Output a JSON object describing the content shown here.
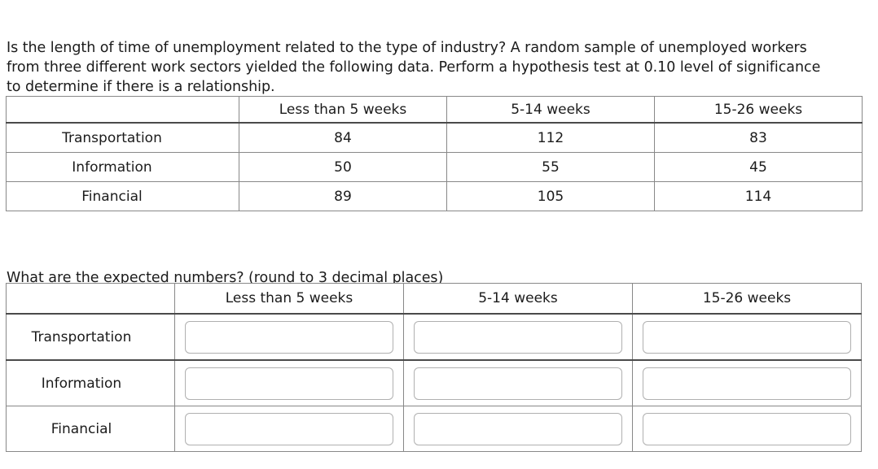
{
  "prompt": {
    "intro": "Is the length of time of unemployment related to the type of industry? A random sample of unemployed workers from three different work sectors yielded the following data. Perform a hypothesis test at 0.10 level of significance to determine if there is a relationship.",
    "expected_question": "What are the expected numbers? (round to 3 decimal places)"
  },
  "observed_table": {
    "corner_label": "",
    "columns": [
      "Less than 5 weeks",
      "5-14 weeks",
      "15-26 weeks"
    ],
    "rows": [
      {
        "label": "Transportation",
        "values": [
          "84",
          "112",
          "83"
        ]
      },
      {
        "label": "Information",
        "values": [
          "50",
          "55",
          "45"
        ]
      },
      {
        "label": "Financial",
        "values": [
          "89",
          "105",
          "114"
        ]
      }
    ]
  },
  "expected_table": {
    "corner_label": "",
    "columns": [
      "Less than 5 weeks",
      "5-14 weeks",
      "15-26 weeks"
    ],
    "rows": [
      {
        "label": "Transportation",
        "values": [
          "",
          "",
          ""
        ],
        "placeholders": [
          "",
          "",
          ""
        ]
      },
      {
        "label": "Information",
        "values": [
          "",
          "",
          ""
        ],
        "placeholders": [
          "",
          "",
          ""
        ]
      },
      {
        "label": "Financial",
        "values": [
          "",
          "",
          ""
        ],
        "placeholders": [
          "",
          "",
          ""
        ]
      }
    ]
  },
  "colors": {
    "text": "#1b1b1b",
    "table_border": "#888888",
    "table_border_strong": "#4a4a4a",
    "input_border": "#b0b0b0",
    "background": "#ffffff"
  }
}
